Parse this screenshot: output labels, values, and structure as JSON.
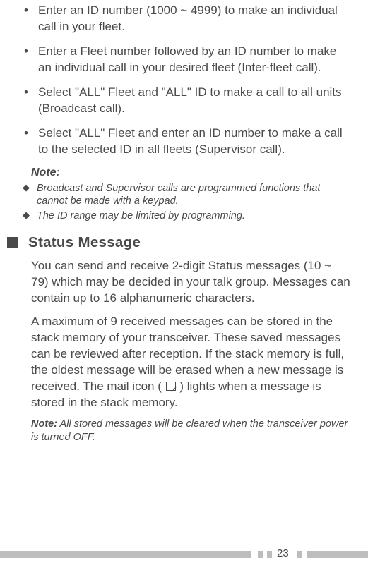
{
  "bullets": [
    "Enter an ID number (1000 ~ 4999) to make an individual call in your fleet.",
    "Enter a Fleet number followed by an ID number to make an individual call in your desired fleet (Inter-fleet call).",
    "Select \"ALL\" Fleet and \"ALL\" ID to make a call to all units (Broadcast call).",
    "Select \"ALL\" Fleet and enter an ID number to make a call to the selected ID in all fleets (Supervisor call)."
  ],
  "note_label": "Note:",
  "diamonds": [
    "Broadcast and Supervisor calls are programmed functions that cannot be made with a keypad.",
    "The ID range may be limited by programming."
  ],
  "section_title": "Status Message",
  "para1": "You can send and receive 2-digit Status messages (10 ~ 79) which may be decided in your talk group.  Messages can contain up to 16 alphanumeric characters.",
  "para2_a": "A maximum of 9 received messages can be stored in the stack memory of your transceiver.  These saved messages can be reviewed after reception.  If the stack memory is full, the oldest message will be erased when a new message is received.  The mail icon (",
  "para2_b": ") lights when a message is stored in the stack memory.",
  "note2_label": "Note:",
  "note2_text": "  All stored messages will be cleared when the transceiver power is turned OFF.",
  "page_number": "23"
}
